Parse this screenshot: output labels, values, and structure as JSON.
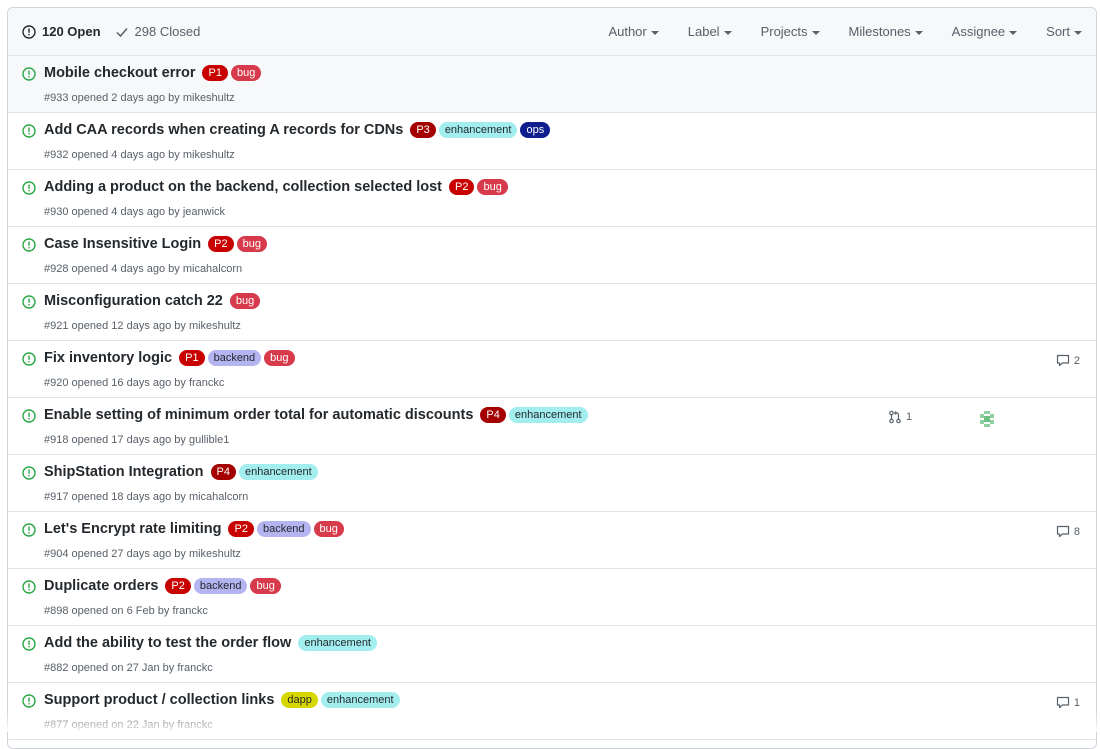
{
  "header": {
    "open_label": "120 Open",
    "closed_label": "298 Closed",
    "filters": [
      "Author",
      "Label",
      "Projects",
      "Milestones",
      "Assignee",
      "Sort"
    ]
  },
  "colors": {
    "open_green": "#28a745",
    "P1": "#c80000",
    "P2": "#c80000",
    "P3": "#a50000",
    "P4": "#a50000",
    "bug": "#d73a4a",
    "enhancement": "#a2eeef",
    "ops": "#0e1e8c",
    "backend": "#b4b4f0",
    "dapp": "#d7d700"
  },
  "issues": [
    {
      "title": "Mobile checkout error",
      "labels": [
        "P1",
        "bug"
      ],
      "meta": "#933 opened 2 days ago by mikeshultz",
      "comments": "",
      "pr": "",
      "avatar": false
    },
    {
      "title": "Add CAA records when creating A records for CDNs",
      "labels": [
        "P3",
        "enhancement",
        "ops"
      ],
      "meta": "#932 opened 4 days ago by mikeshultz",
      "comments": "",
      "pr": "",
      "avatar": false
    },
    {
      "title": "Adding a product on the backend, collection selected lost",
      "labels": [
        "P2",
        "bug"
      ],
      "meta": "#930 opened 4 days ago by jeanwick",
      "comments": "",
      "pr": "",
      "avatar": false
    },
    {
      "title": "Case Insensitive Login",
      "labels": [
        "P2",
        "bug"
      ],
      "meta": "#928 opened 4 days ago by micahalcorn",
      "comments": "",
      "pr": "",
      "avatar": false
    },
    {
      "title": "Misconfiguration catch 22",
      "labels": [
        "bug"
      ],
      "meta": "#921 opened 12 days ago by mikeshultz",
      "comments": "",
      "pr": "",
      "avatar": false
    },
    {
      "title": "Fix inventory logic",
      "labels": [
        "P1",
        "backend",
        "bug"
      ],
      "meta": "#920 opened 16 days ago by franckc",
      "comments": "2",
      "pr": "",
      "avatar": false
    },
    {
      "title": "Enable setting of minimum order total for automatic discounts",
      "labels": [
        "P4",
        "enhancement"
      ],
      "meta": "#918 opened 17 days ago by gullible1",
      "comments": "",
      "pr": "1",
      "avatar": true
    },
    {
      "title": "ShipStation Integration",
      "labels": [
        "P4",
        "enhancement"
      ],
      "meta": "#917 opened 18 days ago by micahalcorn",
      "comments": "",
      "pr": "",
      "avatar": false
    },
    {
      "title": "Let's Encrypt rate limiting",
      "labels": [
        "P2",
        "backend",
        "bug"
      ],
      "meta": "#904 opened 27 days ago by mikeshultz",
      "comments": "8",
      "pr": "",
      "avatar": false
    },
    {
      "title": "Duplicate orders",
      "labels": [
        "P2",
        "backend",
        "bug"
      ],
      "meta": "#898 opened on 6 Feb by franckc",
      "comments": "",
      "pr": "",
      "avatar": false
    },
    {
      "title": "Add the ability to test the order flow",
      "labels": [
        "enhancement"
      ],
      "meta": "#882 opened on 27 Jan by franckc",
      "comments": "",
      "pr": "",
      "avatar": false
    },
    {
      "title": "Support product / collection links",
      "labels": [
        "dapp",
        "enhancement"
      ],
      "meta": "#877 opened on 22 Jan by franckc",
      "comments": "1",
      "pr": "",
      "avatar": false
    }
  ]
}
